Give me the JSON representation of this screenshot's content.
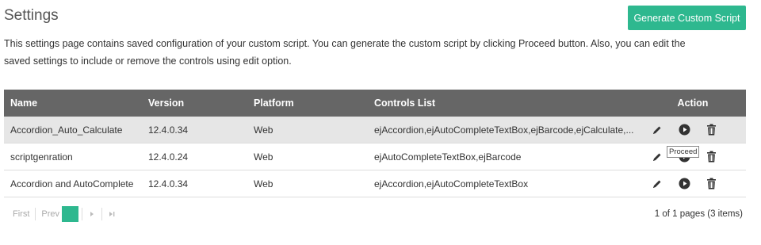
{
  "page": {
    "title": "Settings",
    "generate_button": "Generate Custom Script",
    "description": "This settings page contains saved configuration of your custom script. You can generate the custom script by clicking Proceed button. Also, you can edit the saved settings to include or remove the controls using edit option."
  },
  "table": {
    "columns": {
      "name": "Name",
      "version": "Version",
      "platform": "Platform",
      "controls": "Controls List",
      "action": "Action"
    },
    "rows": [
      {
        "name": "Accordion_Auto_Calculate",
        "version": "12.4.0.34",
        "platform": "Web",
        "controls": "ejAccordion,ejAutoCompleteTextBox,ejBarcode,ejCalculate,..."
      },
      {
        "name": "scriptgenration",
        "version": "12.4.0.24",
        "platform": "Web",
        "controls": "ejAutoCompleteTextBox,ejBarcode"
      },
      {
        "name": "Accordion and AutoComplete",
        "version": "12.4.0.34",
        "platform": "Web",
        "controls": "ejAccordion,ejAutoCompleteTextBox"
      }
    ],
    "selected_row": 0,
    "icons": [
      "pencil-icon",
      "play-circle-icon",
      "trash-icon"
    ]
  },
  "tooltip": "Proceed",
  "pager": {
    "first": "First",
    "prev": "Prev",
    "current_page": "1",
    "info": "1 of 1 pages (3 items)"
  },
  "colors": {
    "accent": "#2eb88f",
    "header_bg": "#666666",
    "selected_row_bg": "#e6e6e6"
  }
}
